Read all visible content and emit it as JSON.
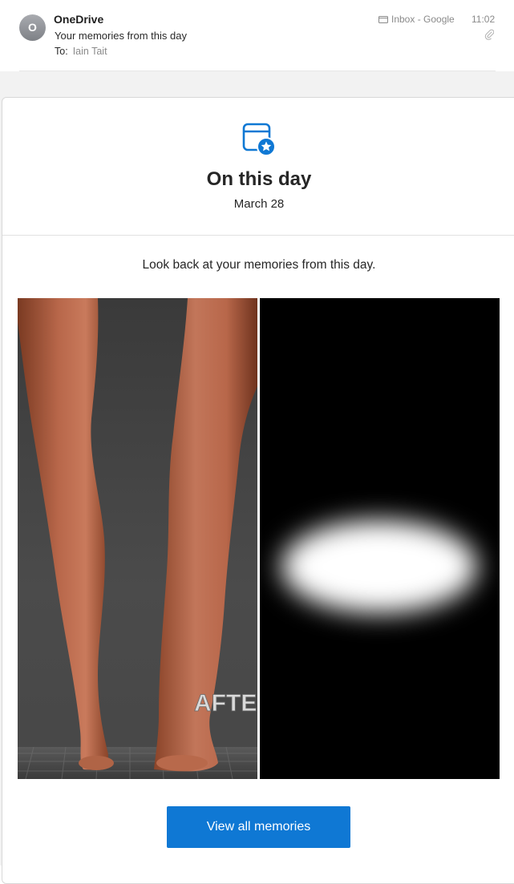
{
  "header": {
    "avatar_initial": "O",
    "sender": "OneDrive",
    "subject": "Your memories from this day",
    "to_label": "To:",
    "to_name": "Iain Tait",
    "mailbox": "Inbox - Google",
    "time": "11:02"
  },
  "hero": {
    "title": "On this day",
    "date": "March 28"
  },
  "body": {
    "intro": "Look back at your memories from this day.",
    "photo_left_overlay": "AFTE",
    "cta_label": "View all memories"
  },
  "colors": {
    "accent": "#0f78d4",
    "backdrop": "#f2f2f2"
  },
  "icons": [
    "folder-icon",
    "paperclip-icon",
    "calendar-star-icon"
  ]
}
